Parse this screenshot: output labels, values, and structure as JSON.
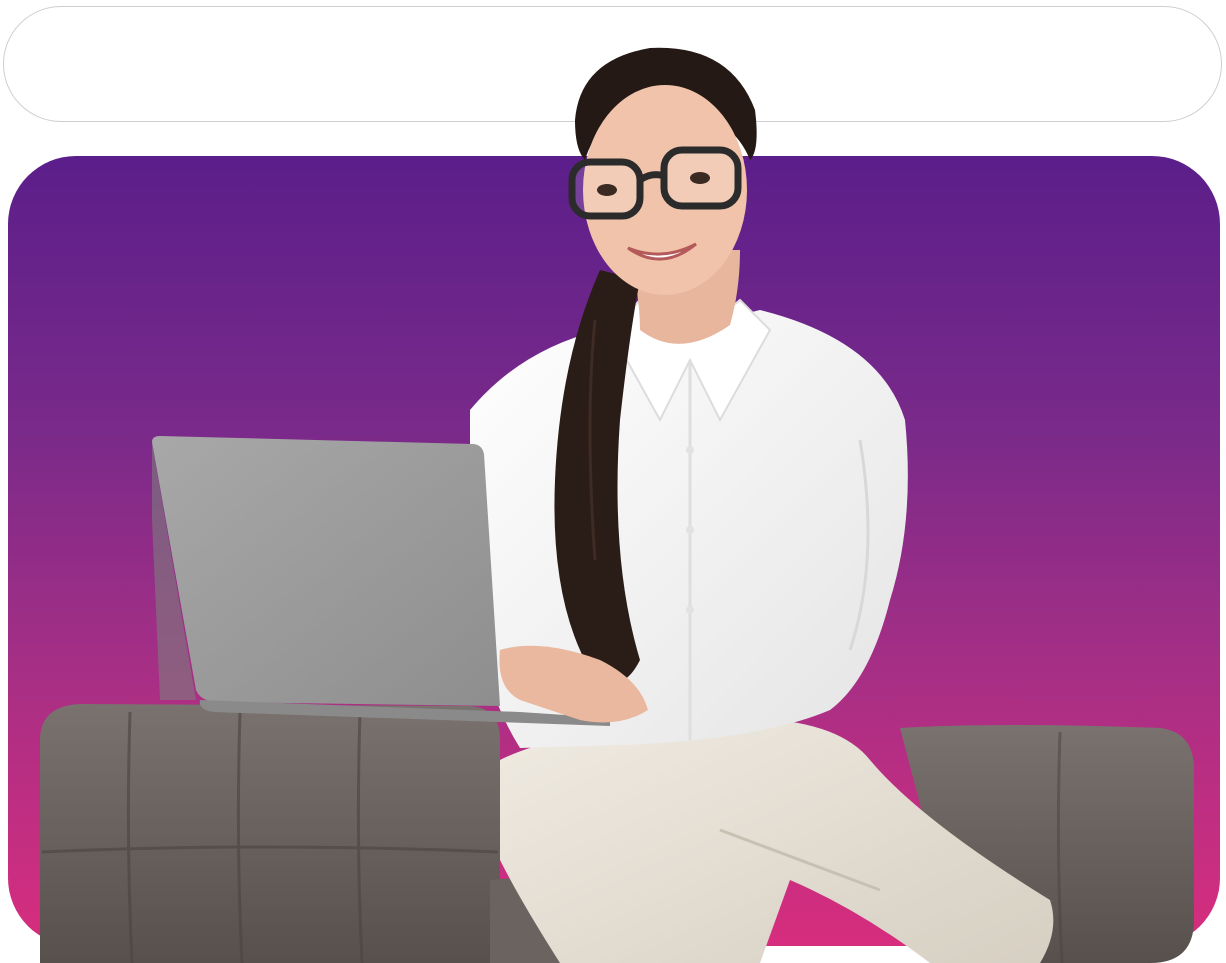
{
  "search_bar": {
    "value": "",
    "placeholder": ""
  },
  "hero": {
    "gradient_top": "#5b1e8a",
    "gradient_bottom": "#d72d7e",
    "image": "woman-with-laptop-on-armchair-illustration"
  },
  "colors": {
    "sofa": "#6e6763",
    "laptop": "#9b9b9b",
    "shirt": "#f5f5f5",
    "trousers": "#e8e2d6",
    "hair": "#241915"
  }
}
